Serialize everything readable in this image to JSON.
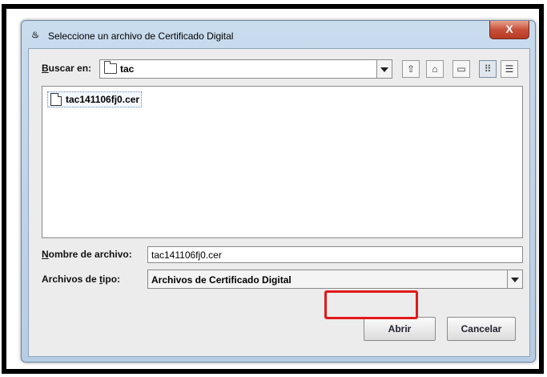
{
  "window": {
    "title": "Seleccione un archivo de Certificado Digital",
    "close_glyph": "X"
  },
  "lookin": {
    "label_mnemonic": "B",
    "label_rest": "uscar en:",
    "value": "tac"
  },
  "toolbar": {
    "icons": [
      "up-folder-icon",
      "home-icon",
      "new-folder-icon",
      "list-view-icon",
      "details-view-icon"
    ]
  },
  "files": [
    {
      "name": "tac141106fj0.cer"
    }
  ],
  "filename": {
    "label_mnemonic": "N",
    "label_rest": "ombre de archivo:",
    "value": "tac141106fj0.cer"
  },
  "filetype": {
    "label_pre": "Archivos de ",
    "label_mnemonic": "t",
    "label_rest": "ipo:",
    "value": "Archivos de Certificado Digital"
  },
  "buttons": {
    "open": "Abrir",
    "cancel": "Cancelar"
  },
  "colors": {
    "highlight": "#e21a1a",
    "close_button": "#c7503a"
  }
}
